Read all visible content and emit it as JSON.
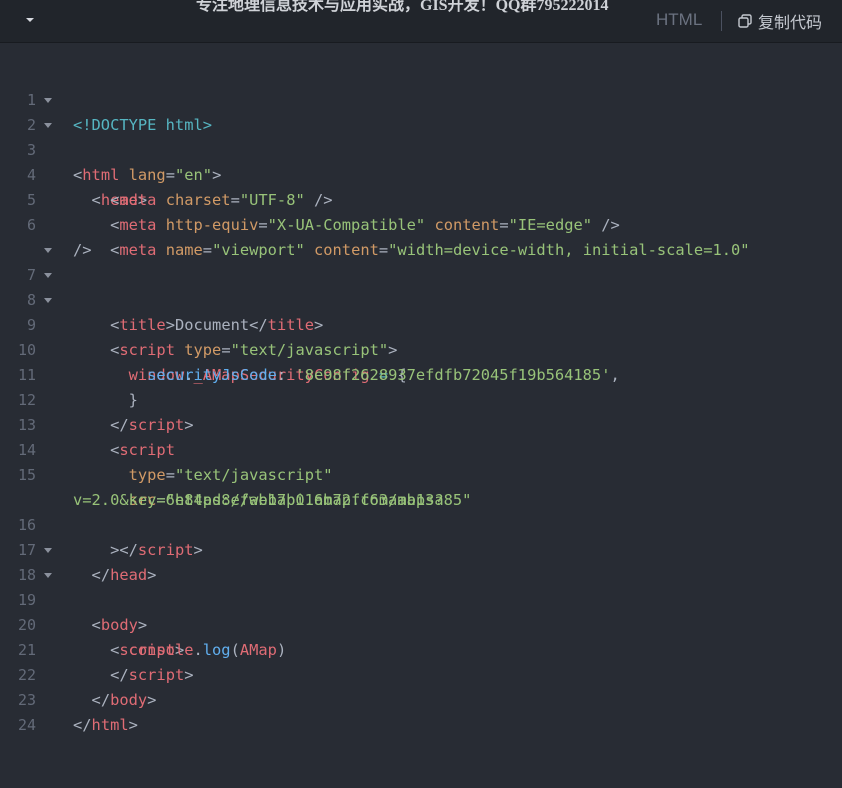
{
  "header": {
    "watermark": "专注地理信息技术与应用实战，GIS开发！QQ群795222014",
    "language": "HTML",
    "copy_label": "复制代码",
    "collapse_icon": "chevron-down-icon",
    "copy_icon": "copy-icon"
  },
  "editor": {
    "line_numbers": [
      "1",
      "2",
      "3",
      "4",
      "5",
      "6",
      "7",
      "8",
      "9",
      "10",
      "11",
      "12",
      "13",
      "14",
      "15",
      "16",
      "17",
      "18",
      "19",
      "20",
      "21",
      "22",
      "23",
      "24"
    ],
    "foldable_lines": [
      2,
      3,
      7,
      8,
      9,
      18,
      19
    ],
    "tokens": {
      "doctype": "<!DOCTYPE html>",
      "lt": "<",
      "gt": ">",
      "lt_slash": "</",
      "self_close": " />",
      "self_close_wrap": "/>",
      "close_bracket_tag": "></",
      "html": "html",
      "lang_attr": " lang",
      "eq": "=",
      "en_val": "\"en\"",
      "head": "head",
      "meta": "meta",
      "charset_attr": " charset",
      "utf8_val": "\"UTF-8\"",
      "http_equiv_attr": " http-equiv",
      "xua_val": "\"X-UA-Compatible\"",
      "content_attr": " content",
      "ie_edge_val": "\"IE=edge\"",
      "name_attr": " name",
      "viewport_val": "\"viewport\"",
      "viewport_content_val": "\"width=device-width, initial-scale=1.0\"",
      "title": "title",
      "document_text": "Document",
      "script": "script",
      "type_attr": " type",
      "type_attr_plain": "type",
      "text_js_val": "\"text/javascript\"",
      "window": "window",
      "dot": ".",
      "amap_security_config": "_AMapSecurityConfig",
      "assign": " = ",
      "open_brace": "{",
      "close_brace": "}",
      "security_js_code": "securityJsCode",
      "colon": ": ",
      "security_code_val": "'8e98f2628937efdfb72045f19b564185'",
      "comma": ",",
      "src_attr": "src",
      "src_val_part1": "\"https://webapi.amap.com/maps?",
      "src_val_part2": "v=2.0&key=6e84ad8efab17b016b72ff63aab13a85\"",
      "body": "body",
      "console": "console",
      "log": "log",
      "open_paren": "(",
      "amap": "AMap",
      "close_paren": ")"
    }
  }
}
